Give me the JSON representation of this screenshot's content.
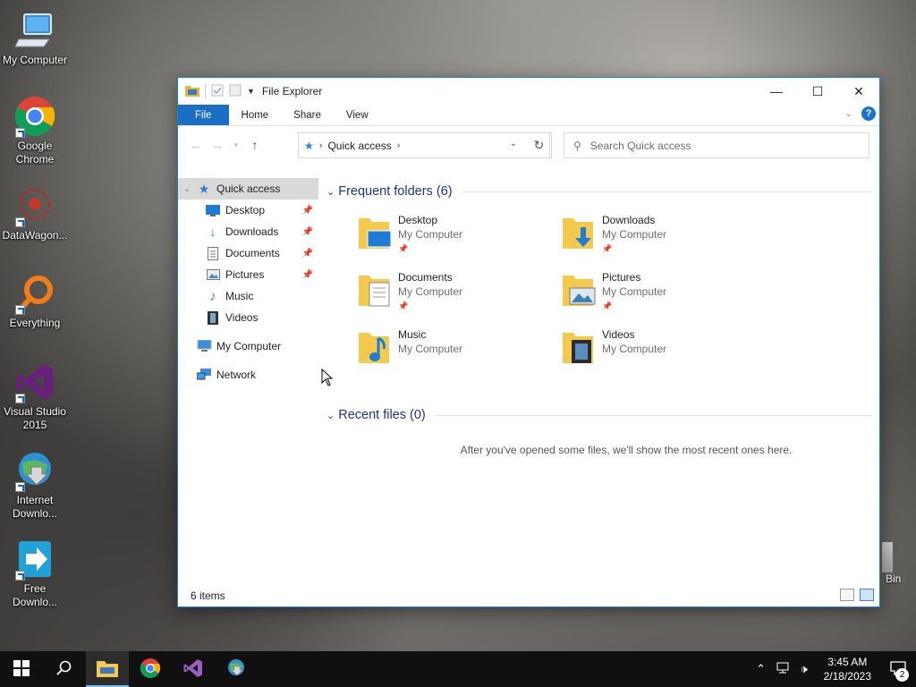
{
  "desktop": {
    "icons": [
      {
        "label": "My Computer",
        "icon": "computer-icon"
      },
      {
        "label": "Google Chrome",
        "icon": "chrome-icon"
      },
      {
        "label": "DataWagon...",
        "icon": "datawagon-icon"
      },
      {
        "label": "Everything",
        "icon": "everything-icon"
      },
      {
        "label": "Visual Studio 2015",
        "icon": "visual-studio-icon"
      },
      {
        "label": "Internet Downlo...",
        "icon": "internet-download-icon"
      },
      {
        "label": "Free Downlo...",
        "icon": "free-download-icon"
      }
    ],
    "recycle_partial_label": "Bin"
  },
  "window": {
    "title": "File Explorer",
    "ribbon_tabs": [
      "File",
      "Home",
      "Share",
      "View"
    ],
    "help_label": "?",
    "address": {
      "location": "Quick access"
    },
    "search": {
      "placeholder": "Search Quick access"
    },
    "nav_pane": {
      "quick_access": "Quick access",
      "children": [
        {
          "label": "Desktop",
          "pinned": true
        },
        {
          "label": "Downloads",
          "pinned": true
        },
        {
          "label": "Documents",
          "pinned": true
        },
        {
          "label": "Pictures",
          "pinned": true
        },
        {
          "label": "Music",
          "pinned": false
        },
        {
          "label": "Videos",
          "pinned": false
        }
      ],
      "my_computer": "My Computer",
      "network": "Network"
    },
    "frequent": {
      "header": "Frequent folders (6)",
      "folders": [
        {
          "name": "Desktop",
          "location": "My Computer",
          "pinned": true
        },
        {
          "name": "Downloads",
          "location": "My Computer",
          "pinned": true
        },
        {
          "name": "Documents",
          "location": "My Computer",
          "pinned": true
        },
        {
          "name": "Pictures",
          "location": "My Computer",
          "pinned": true
        },
        {
          "name": "Music",
          "location": "My Computer",
          "pinned": false
        },
        {
          "name": "Videos",
          "location": "My Computer",
          "pinned": false
        }
      ]
    },
    "recent": {
      "header": "Recent files (0)",
      "empty_message": "After you've opened some files, we'll show the most recent ones here."
    },
    "status": {
      "item_count": "6 items"
    }
  },
  "taskbar": {
    "apps": [
      "start-icon",
      "search-icon",
      "file-explorer-icon",
      "chrome-icon",
      "visual-studio-icon",
      "internet-download-icon"
    ],
    "clock_time": "3:45 AM",
    "clock_date": "2/18/2023",
    "notification_count": "2"
  },
  "colors": {
    "accent": "#1a6fc4",
    "header_blue": "#1e3287",
    "taskbar": "#101010"
  }
}
